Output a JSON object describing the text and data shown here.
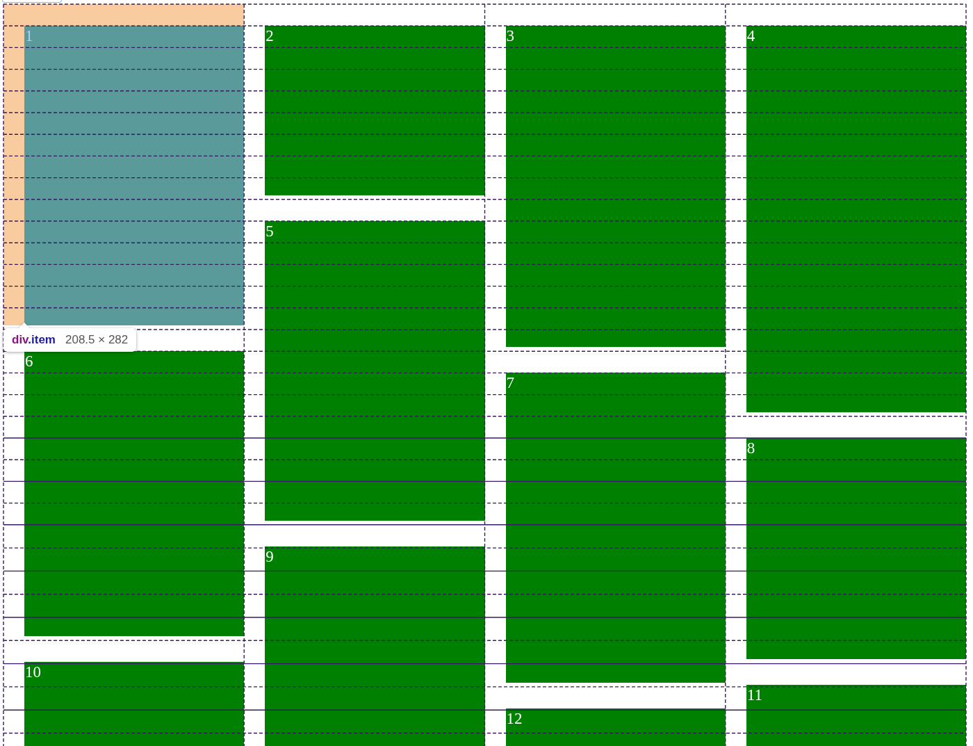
{
  "grid": {
    "items": [
      {
        "label": "1",
        "selected": true
      },
      {
        "label": "2",
        "selected": false
      },
      {
        "label": "3",
        "selected": false
      },
      {
        "label": "4",
        "selected": false
      },
      {
        "label": "5",
        "selected": false
      },
      {
        "label": "6",
        "selected": false
      },
      {
        "label": "7",
        "selected": false
      },
      {
        "label": "8",
        "selected": false
      },
      {
        "label": "9",
        "selected": false
      },
      {
        "label": "10",
        "selected": false
      },
      {
        "label": "11",
        "selected": false
      },
      {
        "label": "12",
        "selected": false
      }
    ]
  },
  "tooltip": {
    "tag": "div",
    "class_name": ".item",
    "size": "208.5 × 282"
  }
}
